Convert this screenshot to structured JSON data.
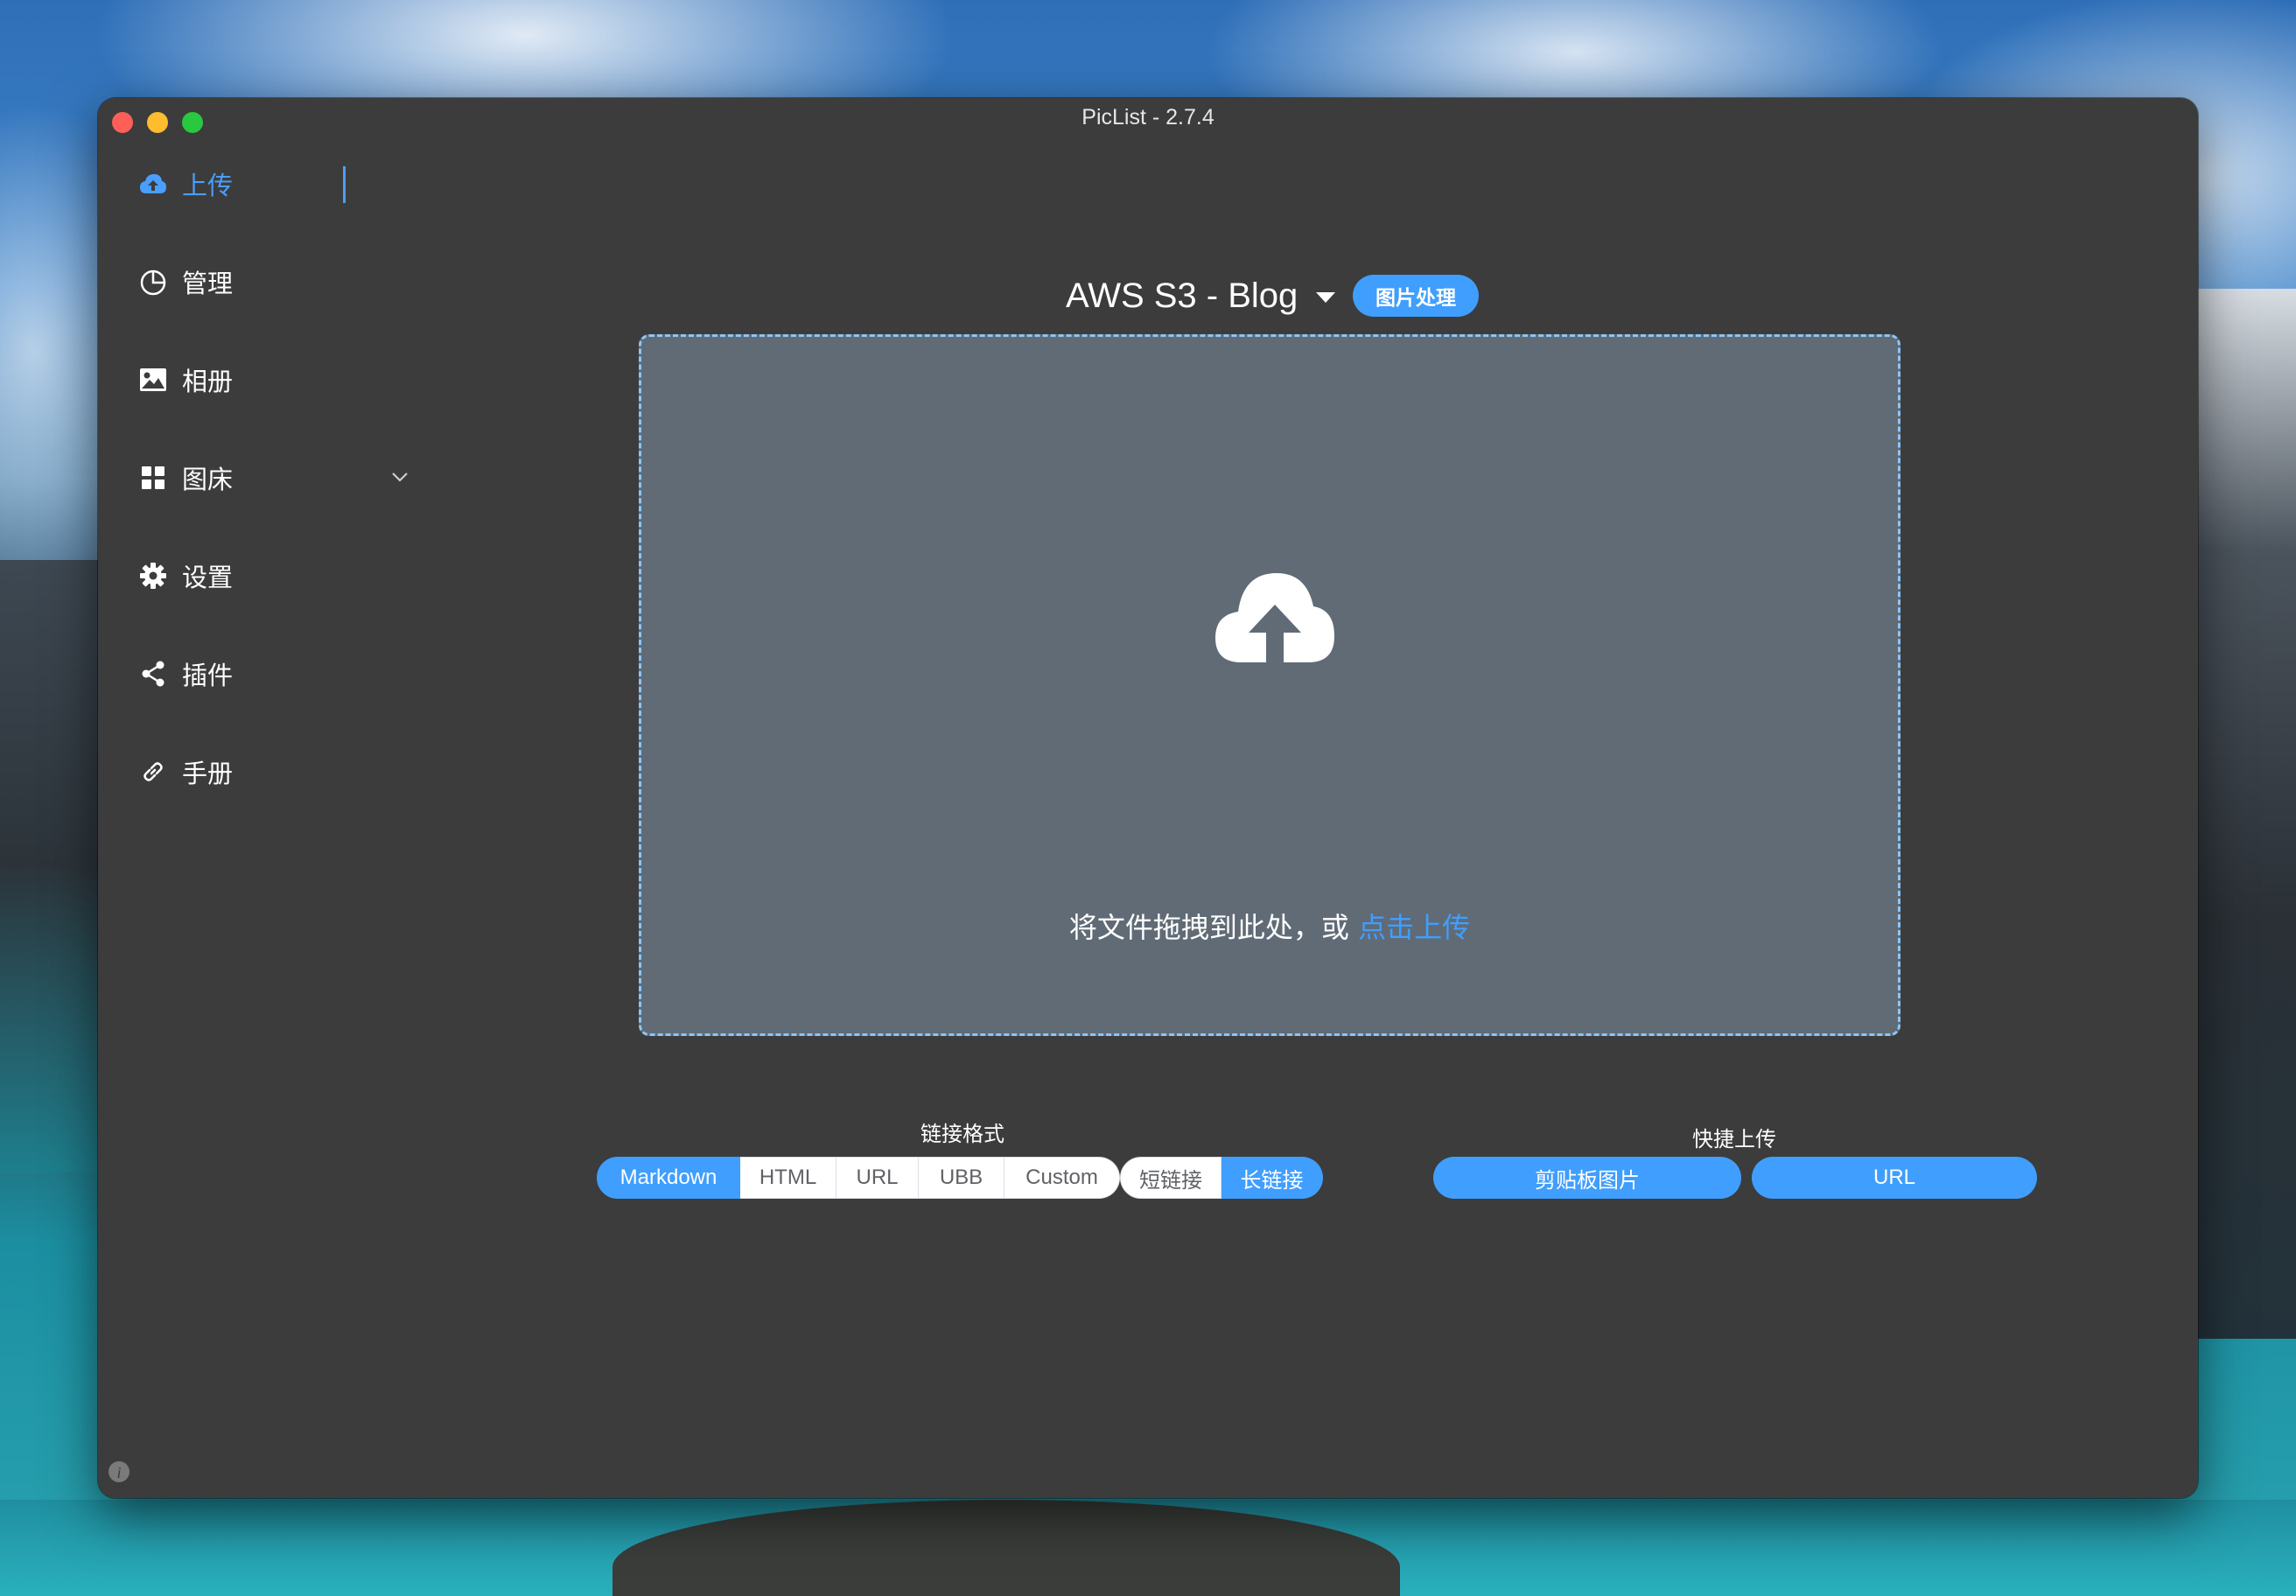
{
  "window": {
    "title": "PicList - 2.7.4"
  },
  "sidebar": {
    "items": [
      {
        "label": "上传",
        "icon": "cloud-upload-icon",
        "active": true
      },
      {
        "label": "管理",
        "icon": "pie-chart-icon",
        "active": false
      },
      {
        "label": "相册",
        "icon": "image-icon",
        "active": false
      },
      {
        "label": "图床",
        "icon": "grid-icon",
        "active": false,
        "expandable": true
      },
      {
        "label": "设置",
        "icon": "gear-icon",
        "active": false
      },
      {
        "label": "插件",
        "icon": "share-icon",
        "active": false
      },
      {
        "label": "手册",
        "icon": "link-icon",
        "active": false
      }
    ]
  },
  "upload": {
    "picbed_name": "AWS S3 - Blog",
    "image_process_label": "图片处理",
    "drop_text": "将文件拖拽到此处，或",
    "click_upload_text": "点击上传"
  },
  "link_format": {
    "label": "链接格式",
    "options": [
      "Markdown",
      "HTML",
      "URL",
      "UBB",
      "Custom"
    ],
    "selected": "Markdown",
    "length_options": [
      "短链接",
      "长链接"
    ],
    "length_selected": "长链接"
  },
  "quick_upload": {
    "label": "快捷上传",
    "clipboard_label": "剪贴板图片",
    "url_label": "URL"
  },
  "colors": {
    "accent": "#409eff",
    "window_bg": "#3c3c3c",
    "dropzone_bg": "#606b76"
  }
}
